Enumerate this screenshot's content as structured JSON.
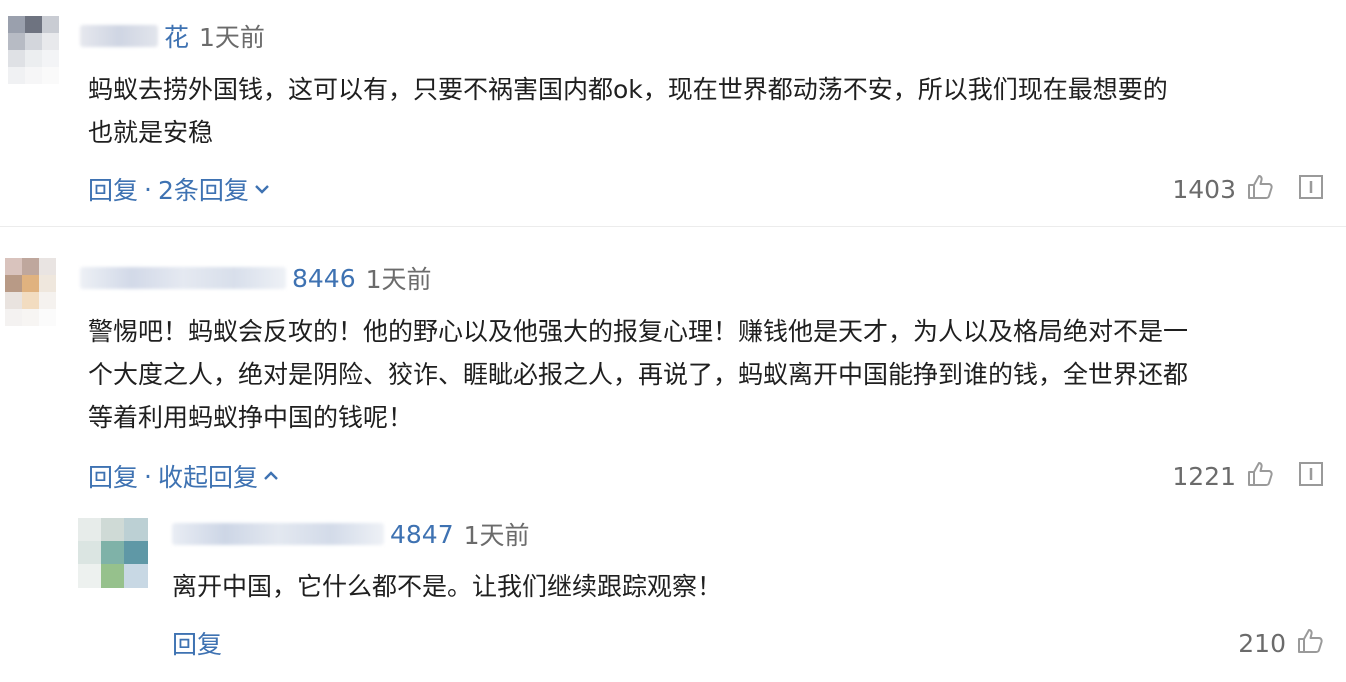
{
  "comments": [
    {
      "name_tail": "花",
      "time": "1天前",
      "text_lines": [
        "蚂蚁去捞外国钱，这可以有，只要不祸害国内都ok，现在世界都动荡不安，所以我们现在最想要的",
        "也就是安稳"
      ],
      "reply_label": "回复",
      "sep": "·",
      "toggle_label": "2条回复",
      "likes": "1403"
    },
    {
      "name_tail": "8446",
      "time": "1天前",
      "text_lines": [
        "警惕吧！蚂蚁会反攻的！他的野心以及他强大的报复心理！赚钱他是天才，为人以及格局绝对不是一",
        "个大度之人，绝对是阴险、狡诈、睚眦必报之人，再说了，蚂蚁离开中国能挣到谁的钱，全世界还都",
        "等着利用蚂蚁挣中国的钱呢！"
      ],
      "reply_label": "回复",
      "sep": "·",
      "toggle_label": "收起回复",
      "likes": "1221"
    }
  ],
  "reply": {
    "name_tail": "4847",
    "time": "1天前",
    "text": "离开中国，它什么都不是。让我们继续跟踪观察！",
    "reply_label": "回复",
    "likes": "210"
  },
  "icons": {
    "like": "thumbs-up-icon",
    "report": "report-icon",
    "expand": "chevron-down-icon",
    "collapse": "chevron-up-icon"
  },
  "colors": {
    "link": "#3e72b2",
    "meta": "#6b6b6b",
    "text": "#1f1f1f"
  }
}
